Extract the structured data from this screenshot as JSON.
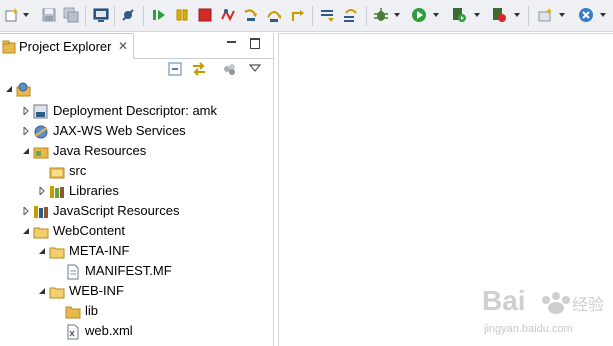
{
  "toolbar": {
    "buttons": [
      {
        "name": "new-icon"
      },
      {
        "name": "save-icon"
      },
      {
        "name": "save-all-icon"
      },
      {
        "name": "open-console-icon"
      },
      {
        "name": "skip-breakpoints-icon"
      },
      {
        "name": "resume-icon"
      },
      {
        "name": "suspend-icon"
      },
      {
        "name": "terminate-icon"
      },
      {
        "name": "disconnect-icon"
      },
      {
        "name": "step-into-icon"
      },
      {
        "name": "step-over-icon"
      },
      {
        "name": "step-return-icon"
      },
      {
        "name": "drop-to-frame-icon"
      },
      {
        "name": "use-step-filters-icon"
      },
      {
        "name": "debug-icon"
      },
      {
        "name": "run-icon"
      },
      {
        "name": "run-server-icon"
      },
      {
        "name": "coverage-icon"
      },
      {
        "name": "new-project-icon"
      },
      {
        "name": "external-tools-icon"
      }
    ]
  },
  "project_explorer": {
    "title": "Project Explorer",
    "close_glyph": "✕",
    "tree": {
      "project_name": "",
      "deployment_descriptor": "Deployment Descriptor: amk",
      "jaxws": "JAX-WS Web Services",
      "java_resources": "Java Resources",
      "src": "src",
      "libraries": "Libraries",
      "js_resources": "JavaScript Resources",
      "webcontent": "WebContent",
      "meta_inf": "META-INF",
      "manifest": "MANIFEST.MF",
      "web_inf": "WEB-INF",
      "lib": "lib",
      "web_xml": "web.xml"
    }
  },
  "watermark": {
    "brand": "Bai du 经验",
    "url": "jingyan.baidu.com"
  },
  "colors": {
    "toolbar_bg": "#eef0f4",
    "folder": "#e8b84a",
    "run_green": "#2e9e3e",
    "terminate_red": "#d42a2a"
  }
}
